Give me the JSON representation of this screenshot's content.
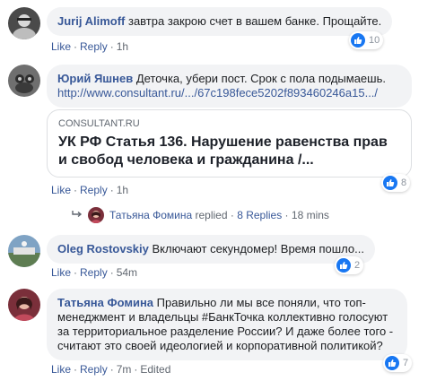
{
  "comments": [
    {
      "author": "Jurij Alimoff",
      "text": "завтра закрою счет в вашем банке. Прощайте.",
      "like": "Like",
      "reply": "Reply",
      "time": "1h",
      "reactions": "10"
    },
    {
      "author": "Юрий Яшнев",
      "text": "Деточка, убери пост. Срок с пола подымаешь.",
      "link": "http://www.consultant.ru/.../67c198fece5202f893460246a15.../",
      "preview_domain": "CONSULTANT.RU",
      "preview_title": "УК РФ Статья 136. Нарушение равенства прав и свобод человека и гражданина /...",
      "like": "Like",
      "reply": "Reply",
      "time": "1h",
      "reactions": "8",
      "replies": {
        "replier": "Татьяна Фомина",
        "replied": "replied",
        "count": "8 Replies",
        "time": "18 mins"
      }
    },
    {
      "author": "Oleg Rostovskiy",
      "text": "Включают секундомер! Время пошло...",
      "like": "Like",
      "reply": "Reply",
      "time": "54m",
      "reactions": "2"
    },
    {
      "author": "Татьяна Фомина",
      "text": "Правильно ли мы все поняли, что топ-менеджмент и владельцы #БанкТочка коллективно голосуют за территориальное разделение России? И даже более того - считают это своей идеологией и корпоративной политикой?",
      "like": "Like",
      "reply": "Reply",
      "time": "7m",
      "edited": "Edited",
      "reactions": "7"
    }
  ],
  "colors": {
    "link": "#385898",
    "bubble": "#f2f3f5",
    "like_blue": "#1877f2",
    "meta": "#606770"
  },
  "icons": {
    "like": "thumbs-up-icon",
    "reply_arrow": "reply-arrow-icon"
  }
}
